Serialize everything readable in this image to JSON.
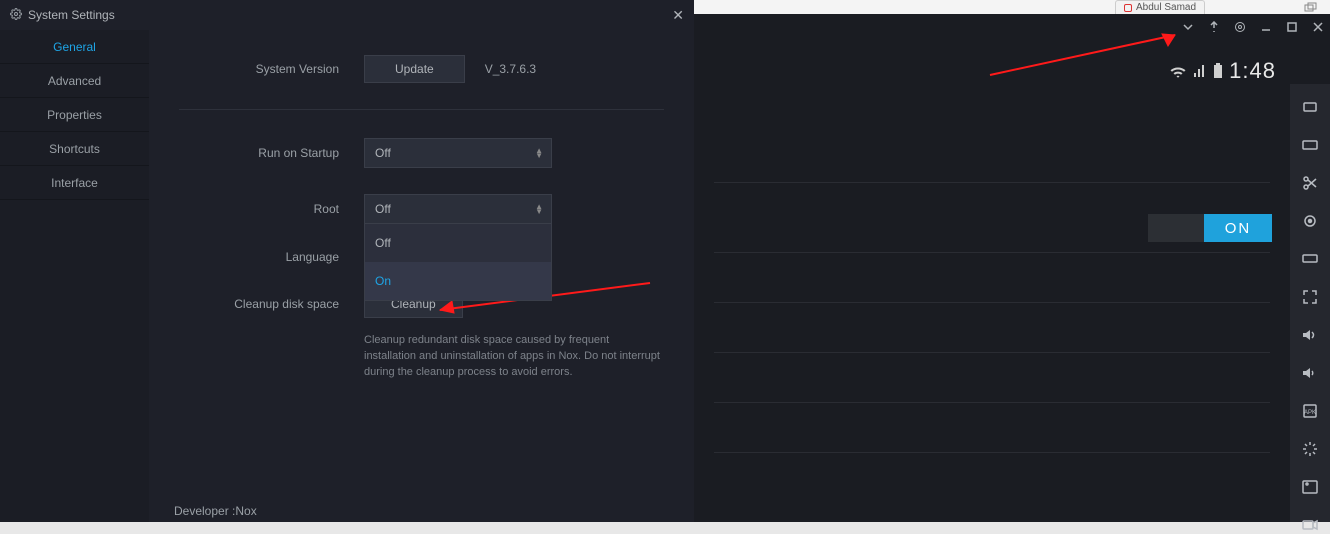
{
  "settings": {
    "window_title": "System Settings",
    "tabs": [
      "General",
      "Advanced",
      "Properties",
      "Shortcuts",
      "Interface"
    ],
    "active_tab": 0,
    "system_version": {
      "label": "System Version",
      "button": "Update",
      "value": "V_3.7.6.3"
    },
    "run_on_startup": {
      "label": "Run on Startup",
      "value": "Off"
    },
    "root": {
      "label": "Root",
      "value": "Off",
      "options": [
        "Off",
        "On"
      ],
      "highlighted": "On"
    },
    "language": {
      "label": "Language"
    },
    "cleanup": {
      "label": "Cleanup disk space",
      "button": "Cleanup",
      "help": "Cleanup redundant disk space caused by frequent installation and uninstallation of apps in Nox. Do not interrupt during the cleanup process to avoid errors."
    },
    "footer": "Developer :Nox"
  },
  "emulator": {
    "titlebar_icons": [
      "chevron-down-icon",
      "pin-icon",
      "gear-icon",
      "minimize-icon",
      "maximize-icon",
      "close-icon"
    ],
    "status": {
      "clock": "1:48"
    },
    "toggle_label": "ON",
    "tool_icons": [
      "rotate-icon",
      "keyboard-icon",
      "scissors-icon",
      "location-icon",
      "display-icon",
      "fullscreen-icon",
      "volume-up-icon",
      "volume-down-icon",
      "apk-icon",
      "loading-icon",
      "folder-icon",
      "record-icon"
    ]
  },
  "browser": {
    "tab_label": "Abdul Samad"
  }
}
